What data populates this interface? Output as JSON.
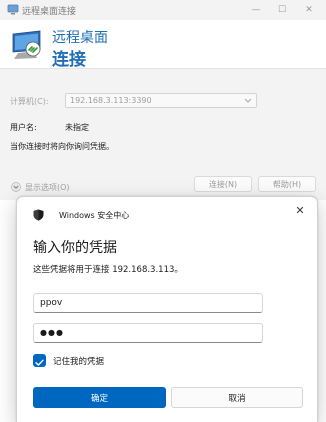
{
  "rdc_window": {
    "title": "远程桌面连接",
    "controls": {
      "minimize": "—",
      "maximize": "☐",
      "close": "✕"
    },
    "header": {
      "subtitle": "远程桌面",
      "title": "连接"
    },
    "computer_label": "计算机(C):",
    "computer_value": "192.168.3.113:3390",
    "username_label": "用户名:",
    "username_value": "未指定",
    "prompt_note": "当你连接时将向你询问凭据。",
    "show_options": "显示选项(O)",
    "connect_button": "连接(N)",
    "help_button": "帮助(H)"
  },
  "credential_dialog": {
    "app_title": "Windows 安全中心",
    "close_glyph": "✕",
    "heading": "输入你的凭据",
    "description": "这些凭据将用于连接 192.168.3.113。",
    "username_value": "ppov",
    "password_mask": "●●●",
    "remember_label": "记住我的凭据",
    "remember_checked": true,
    "ok_button": "确定",
    "cancel_button": "取消"
  },
  "colors": {
    "accent": "#0067c0",
    "rdc_header_text": "#1f6fb6",
    "window_background": "#f3f3f3"
  },
  "icons": {
    "rdc_title": "remote-desktop-icon",
    "rdc_header": "remote-desktop-logo",
    "combo": "chevron-down-icon",
    "options": "chevron-down-circle-icon",
    "security": "windows-security-shield-icon",
    "checkbox": "checkmark-icon"
  }
}
